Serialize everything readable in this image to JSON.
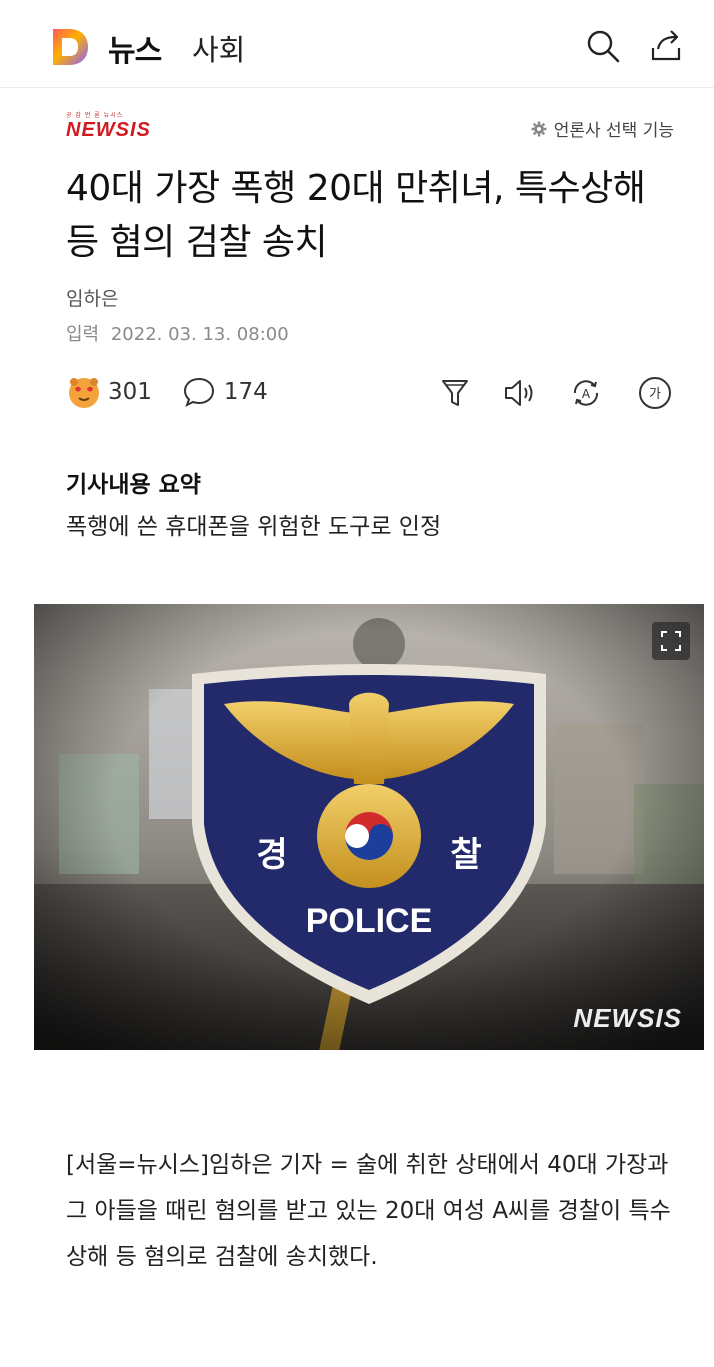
{
  "header": {
    "logo_letter": "D",
    "service_name": "뉴스",
    "section_name": "사회",
    "icons": [
      "search-icon",
      "share-icon"
    ]
  },
  "press": {
    "tagline": "공 감 언 론 뉴시스",
    "name": "NEWSIS",
    "select_label": "언론사 선택 기능"
  },
  "article": {
    "headline": "40대 가장 폭행 20대 만취녀, 특수상해 등 혐의 검찰 송치",
    "author": "임하은",
    "date_label": "입력",
    "date_value": "2022. 03. 13. 08:00",
    "reaction_count": "301",
    "comment_count": "174",
    "tool_icons": [
      "summary-filter-icon",
      "listen-icon",
      "translate-icon",
      "font-size-icon"
    ],
    "font_icon_glyph": "가",
    "translate_glyph": "A",
    "summary_title": "기사내용 요약",
    "summary_text": "폭행에 쓴 휴대폰을 위험한 도구로 인정",
    "photo": {
      "emblem_left": "경",
      "emblem_right": "찰",
      "emblem_text": "POLICE",
      "watermark": "NEWSIS"
    },
    "body": "[서울=뉴시스]임하은 기자 = 술에 취한 상태에서 40대 가장과 그 아들을 때린 혐의를 받고 있는 20대 여성 A씨를 경찰이 특수상해 등 혐의로 검찰에 송치했다."
  },
  "colors": {
    "brand_d_yellow": "#f7b500",
    "brand_d_blue": "#3a6cf4",
    "brand_d_red": "#ff4b4b",
    "press_red": "#d11a1f",
    "emblem_navy": "#222a6e",
    "emblem_gold": "#d9a82c"
  }
}
